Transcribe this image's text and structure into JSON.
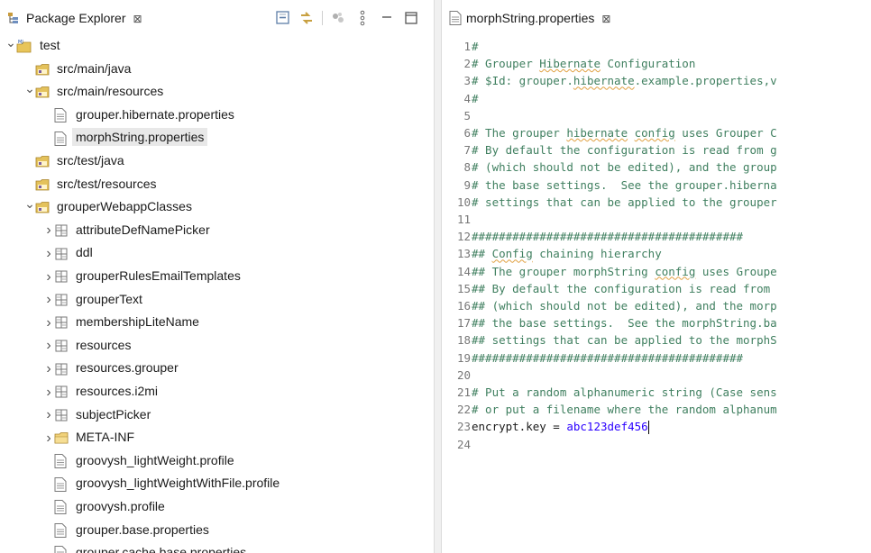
{
  "package_explorer": {
    "tab_title": "Package Explorer",
    "close_symbol": "⊠",
    "toolbar": [
      "collapse-all-icon",
      "link-with-editor-icon",
      "filters-icon",
      "view-menu-icon",
      "minimize-icon",
      "maximize-icon"
    ]
  },
  "tree": [
    {
      "depth": 0,
      "chevron": "down",
      "icon": "project-icon",
      "label": "test"
    },
    {
      "depth": 1,
      "chevron": "none",
      "icon": "source-folder-icon",
      "label": "src/main/java"
    },
    {
      "depth": 1,
      "chevron": "down",
      "icon": "source-folder-icon",
      "label": "src/main/resources"
    },
    {
      "depth": 2,
      "chevron": "none",
      "icon": "file-icon",
      "label": "grouper.hibernate.properties"
    },
    {
      "depth": 2,
      "chevron": "none",
      "icon": "file-icon",
      "label": "morphString.properties",
      "selected": true
    },
    {
      "depth": 1,
      "chevron": "none",
      "icon": "source-folder-icon",
      "label": "src/test/java"
    },
    {
      "depth": 1,
      "chevron": "none",
      "icon": "source-folder-icon",
      "label": "src/test/resources"
    },
    {
      "depth": 1,
      "chevron": "down",
      "icon": "source-folder-icon",
      "label": "grouperWebappClasses"
    },
    {
      "depth": 2,
      "chevron": "right",
      "icon": "package-icon",
      "label": "attributeDefNamePicker"
    },
    {
      "depth": 2,
      "chevron": "right",
      "icon": "package-icon",
      "label": "ddl"
    },
    {
      "depth": 2,
      "chevron": "right",
      "icon": "package-icon",
      "label": "grouperRulesEmailTemplates"
    },
    {
      "depth": 2,
      "chevron": "right",
      "icon": "package-icon",
      "label": "grouperText"
    },
    {
      "depth": 2,
      "chevron": "right",
      "icon": "package-icon",
      "label": "membershipLiteName"
    },
    {
      "depth": 2,
      "chevron": "right",
      "icon": "package-icon",
      "label": "resources"
    },
    {
      "depth": 2,
      "chevron": "right",
      "icon": "package-icon",
      "label": "resources.grouper"
    },
    {
      "depth": 2,
      "chevron": "right",
      "icon": "package-icon",
      "label": "resources.i2mi"
    },
    {
      "depth": 2,
      "chevron": "right",
      "icon": "package-icon",
      "label": "subjectPicker"
    },
    {
      "depth": 2,
      "chevron": "right",
      "icon": "folder-icon",
      "label": "META-INF"
    },
    {
      "depth": 2,
      "chevron": "none",
      "icon": "file-icon",
      "label": "groovysh_lightWeight.profile"
    },
    {
      "depth": 2,
      "chevron": "none",
      "icon": "file-icon",
      "label": "groovysh_lightWeightWithFile.profile"
    },
    {
      "depth": 2,
      "chevron": "none",
      "icon": "file-icon",
      "label": "groovysh.profile"
    },
    {
      "depth": 2,
      "chevron": "none",
      "icon": "file-icon",
      "label": "grouper.base.properties"
    },
    {
      "depth": 2,
      "chevron": "none",
      "icon": "file-icon",
      "label": "grouper.cache.base.properties"
    }
  ],
  "editor": {
    "tab_title": "morphString.properties",
    "close_symbol": "⊠",
    "lines": [
      {
        "n": "1",
        "text": "#"
      },
      {
        "n": "2",
        "text": "# Grouper Hibernate Configuration"
      },
      {
        "n": "3",
        "text": "# $Id: grouper.hibernate.example.properties,v"
      },
      {
        "n": "4",
        "text": "#"
      },
      {
        "n": "5",
        "text": ""
      },
      {
        "n": "6",
        "text": "# The grouper hibernate config uses Grouper C"
      },
      {
        "n": "7",
        "text": "# By default the configuration is read from g"
      },
      {
        "n": "8",
        "text": "# (which should not be edited), and the group"
      },
      {
        "n": "9",
        "text": "# the base settings.  See the grouper.hiberna"
      },
      {
        "n": "10",
        "text": "# settings that can be applied to the grouper"
      },
      {
        "n": "11",
        "text": ""
      },
      {
        "n": "12",
        "text": "########################################"
      },
      {
        "n": "13",
        "text": "## Config chaining hierarchy"
      },
      {
        "n": "14",
        "text": "## The grouper morphString config uses Groupe"
      },
      {
        "n": "15",
        "text": "## By default the configuration is read from"
      },
      {
        "n": "16",
        "text": "## (which should not be edited), and the morp"
      },
      {
        "n": "17",
        "text": "## the base settings.  See the morphString.ba"
      },
      {
        "n": "18",
        "text": "## settings that can be applied to the morphS"
      },
      {
        "n": "19",
        "text": "########################################"
      },
      {
        "n": "20",
        "text": ""
      },
      {
        "n": "21",
        "text": "# Put a random alphanumeric string (Case sens"
      },
      {
        "n": "22",
        "text": "# or put a filename where the random alphanum"
      },
      {
        "n": "23",
        "key": "encrypt.key = ",
        "value": "abc123def456"
      },
      {
        "n": "24",
        "text": ""
      }
    ]
  },
  "colors": {
    "comment": "#3f7f5f",
    "value": "#2a00ff",
    "line_number": "#787878",
    "selection": "#e8e8e8"
  }
}
